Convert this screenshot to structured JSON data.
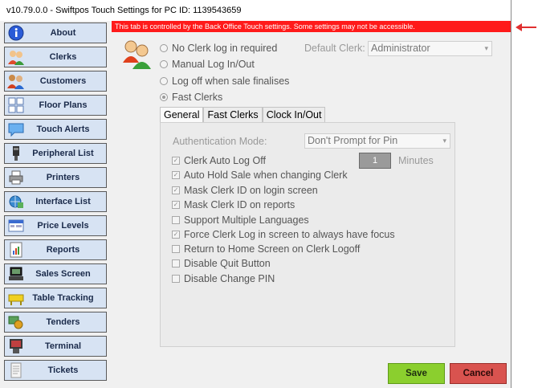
{
  "window": {
    "title": "v10.79.0.0 - Swiftpos Touch  Settings for PC ID: 1139543659",
    "notice": "This tab is controlled by the Back Office Touch settings. Some settings may not be accessible."
  },
  "sidebar": {
    "items": [
      {
        "label": "About",
        "icon": "info-icon"
      },
      {
        "label": "Clerks",
        "icon": "clerks-icon"
      },
      {
        "label": "Customers",
        "icon": "customers-icon"
      },
      {
        "label": "Floor Plans",
        "icon": "floor-plans-icon"
      },
      {
        "label": "Touch Alerts",
        "icon": "touch-alerts-icon"
      },
      {
        "label": "Peripheral List",
        "icon": "peripheral-list-icon"
      },
      {
        "label": "Printers",
        "icon": "printer-icon"
      },
      {
        "label": "Interface List",
        "icon": "interface-list-icon"
      },
      {
        "label": "Price Levels",
        "icon": "price-levels-icon"
      },
      {
        "label": "Reports",
        "icon": "reports-icon"
      },
      {
        "label": "Sales Screen",
        "icon": "sales-screen-icon"
      },
      {
        "label": "Table Tracking",
        "icon": "table-tracking-icon"
      },
      {
        "label": "Tenders",
        "icon": "tenders-icon"
      },
      {
        "label": "Terminal",
        "icon": "terminal-icon"
      },
      {
        "label": "Tickets",
        "icon": "tickets-icon"
      }
    ]
  },
  "login_mode": {
    "options": [
      {
        "label": "No Clerk log in required",
        "selected": false
      },
      {
        "label": "Manual Log In/Out",
        "selected": false
      },
      {
        "label": "Log off when sale finalises",
        "selected": false
      },
      {
        "label": "Fast Clerks",
        "selected": true
      }
    ],
    "default_clerk_label": "Default Clerk:",
    "default_clerk_value": "Administrator"
  },
  "tabs": [
    "General",
    "Fast Clerks",
    "Clock In/Out"
  ],
  "general": {
    "auth_mode_label": "Authentication Mode:",
    "auth_mode_value": "Don't Prompt for Pin",
    "minutes_value": "1",
    "minutes_label": "Minutes",
    "options": [
      {
        "label": "Clerk Auto Log Off",
        "checked": true
      },
      {
        "label": "Auto Hold Sale when changing Clerk",
        "checked": true
      },
      {
        "label": "Mask Clerk ID on login screen",
        "checked": true
      },
      {
        "label": "Mask Clerk ID on reports",
        "checked": true
      },
      {
        "label": "Support Multiple Languages",
        "checked": false
      },
      {
        "label": "Force Clerk Log in screen to always have focus",
        "checked": true
      },
      {
        "label": "Return to Home Screen on Clerk Logoff",
        "checked": false
      },
      {
        "label": "Disable Quit Button",
        "checked": false
      },
      {
        "label": "Disable Change PIN",
        "checked": false
      }
    ]
  },
  "actions": {
    "save": "Save",
    "cancel": "Cancel"
  },
  "colors": {
    "notice_bar": "#ff1a1a",
    "save": "#8bcf2e",
    "cancel": "#d9534f",
    "sidebar_button": "#d7e3f3"
  }
}
